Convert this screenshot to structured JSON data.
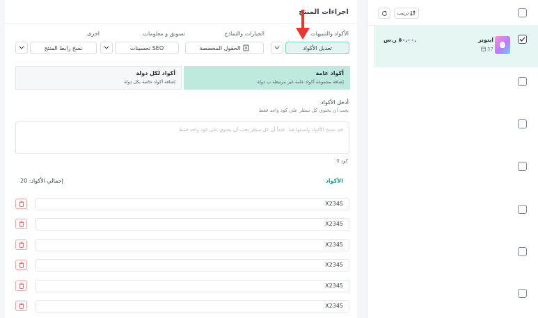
{
  "product_actions": {
    "title": "اجراءات المنتج",
    "groups": [
      {
        "label": "الأكواد والتنبيهات",
        "value": "تعديل الأكواد"
      },
      {
        "label": "الخيارات والنماذج",
        "value": "الحقول المخصصة"
      },
      {
        "label": "تسويق و معلومات",
        "value": "تحسينات SEO"
      },
      {
        "label": "اخرى",
        "value": "نسخ رابط المنتج"
      }
    ]
  },
  "code_types": {
    "general": {
      "title": "أكواد عامة",
      "desc": "إضافة مجموعة أكواد عامة غير مرتبطة ب دولة"
    },
    "per_country": {
      "title": "أكواد لكل دولة",
      "desc": "إضافة أكواد خاصة بكل دولة"
    }
  },
  "codes_input": {
    "label": "أدخل الأكواد",
    "hint": "يجب ان يحتوي كل سطر على كود واحد فقط",
    "placeholder": "قم بنسخ الأكواد ولصقها هنا، علماً أن كل سطر يجب أن يحتوي على كود واحد فقط",
    "count": "0 كود"
  },
  "codes_table": {
    "header_codes": "الأكواد",
    "header_total": "إجمالي الأكواد: 20",
    "rows": [
      "X2345",
      "X2345",
      "X2345",
      "X2345",
      "X2345",
      "X2345"
    ]
  },
  "list": {
    "sort_label": "ترتيب",
    "product": {
      "name": "ايتونز",
      "qty": "57",
      "price": "٥٠.٠٠ ر.س."
    }
  },
  "colors": {
    "accent": "#1d9a86",
    "selected_bg": "#bfe9de",
    "arrow": "#e53935"
  }
}
